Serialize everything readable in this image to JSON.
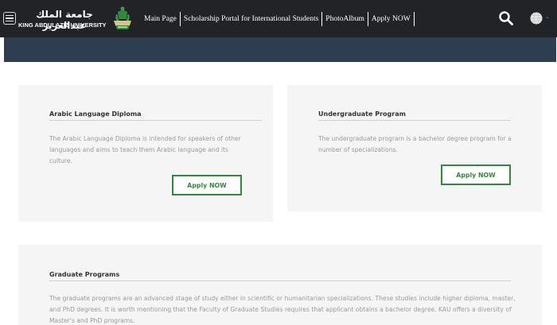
{
  "header": {
    "university_name_arabic": "جامعة الملك عبدالعزيز",
    "university_name_english": "KING ABDULAZIZ UNIVERSITY",
    "nav_items": [
      {
        "label": "Main Page"
      },
      {
        "label": "Scholarship Portal for International Students"
      },
      {
        "label": "PhotoAlbum"
      },
      {
        "label": "Apply NOW"
      }
    ],
    "language_indicator": "-",
    "icons": {
      "menu": "hamburger-menu-icon",
      "logo": "university-emblem-icon",
      "search": "search-icon",
      "language": "globe-icon"
    }
  },
  "programs": [
    {
      "title": "Arabic Language Diploma",
      "description": "The Arabic Language Diploma is intended for speakers of other languages and aims to teach them Arabic language and its culture.",
      "button_label": "Apply NOW"
    },
    {
      "title": "Undergraduate Program",
      "description": "The undergraduate program is a bachelor degree program for a number of specializations.",
      "button_label": "Apply NOW"
    },
    {
      "title": "Graduate Programs",
      "description": "The graduate programs are an advanced stage of study either in scientific or humanitarian specializations. These studies include higher diploma, master, and PhD degrees. It is worth mentioning that the Faculty of Graduate Studies requires that applicant obtains a bachelor degree. KAU offers a diversity of Master's and PhD programs."
    }
  ],
  "colors": {
    "topbar": "#212327",
    "hero": "#2c3e50",
    "card_background": "#f5f5f5",
    "accent_green": "#2e8b3e",
    "language_indicator": "#3a8bdc"
  }
}
